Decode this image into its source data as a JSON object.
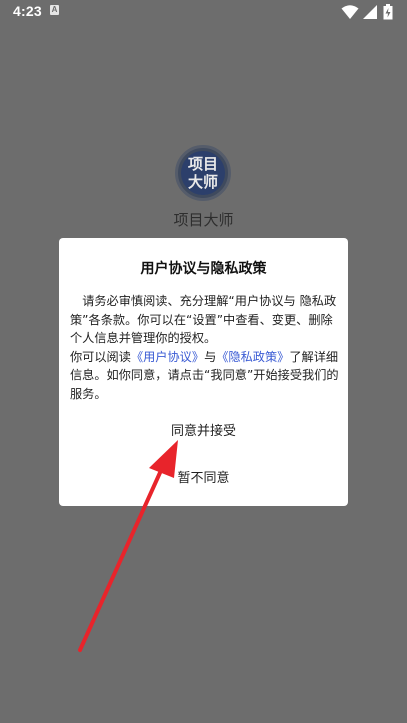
{
  "status_bar": {
    "time": "4:23",
    "notification_letter": "A"
  },
  "app": {
    "logo_text": "项目大师",
    "name": "项目大师"
  },
  "dialog": {
    "title": "用户协议与隐私政策",
    "paragraph1": "请务必审慎阅读、充分理解“用户协议与 隐私政策”各条款。你可以在“设置”中查看、变更、删除个人信息并管理你的授权。",
    "paragraph2_prefix": "你可以阅读",
    "user_agreement_link": "《用户协议》",
    "paragraph2_mid": "与",
    "privacy_policy_link": "《隐私政策》",
    "paragraph2_suffix": "了解详细信息。如你同意，请点击“我同意”开始接受我们的服务。",
    "accept_label": "同意并接受",
    "decline_label": "暂不同意"
  },
  "colors": {
    "overlay": "#6d6d6d",
    "link": "#3a5bd4",
    "annotation_arrow": "#e8242b"
  }
}
